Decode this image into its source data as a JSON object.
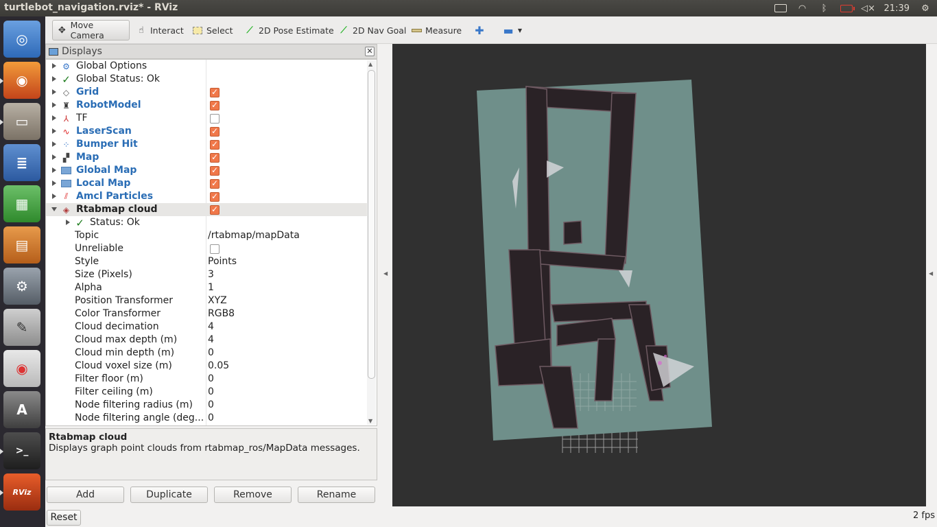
{
  "window": {
    "title": "turtlebot_navigation.rviz* - RViz"
  },
  "tray": {
    "clock": "21:39"
  },
  "toolbar": {
    "move_camera": "Move Camera",
    "interact": "Interact",
    "select": "Select",
    "pose_estimate": "2D Pose Estimate",
    "nav_goal": "2D Nav Goal",
    "measure": "Measure"
  },
  "displays": {
    "title": "Displays",
    "items": [
      {
        "label": "Global Options"
      },
      {
        "label": "Global Status: Ok"
      },
      {
        "label": "Grid"
      },
      {
        "label": "RobotModel"
      },
      {
        "label": "TF"
      },
      {
        "label": "LaserScan"
      },
      {
        "label": "Bumper Hit"
      },
      {
        "label": "Map"
      },
      {
        "label": "Global Map"
      },
      {
        "label": "Local Map"
      },
      {
        "label": "Amcl Particles"
      },
      {
        "label": "Rtabmap cloud"
      },
      {
        "label": "Status: Ok"
      }
    ],
    "properties": [
      {
        "label": "Topic",
        "value": "/rtabmap/mapData"
      },
      {
        "label": "Unreliable",
        "value": ""
      },
      {
        "label": "Style",
        "value": "Points"
      },
      {
        "label": "Size (Pixels)",
        "value": "3"
      },
      {
        "label": "Alpha",
        "value": "1"
      },
      {
        "label": "Position Transformer",
        "value": "XYZ"
      },
      {
        "label": "Color Transformer",
        "value": "RGB8"
      },
      {
        "label": "Cloud decimation",
        "value": "4"
      },
      {
        "label": "Cloud max depth (m)",
        "value": "4"
      },
      {
        "label": "Cloud min depth (m)",
        "value": "0"
      },
      {
        "label": "Cloud voxel size (m)",
        "value": "0.05"
      },
      {
        "label": "Filter floor (m)",
        "value": "0"
      },
      {
        "label": "Filter ceiling (m)",
        "value": "0"
      },
      {
        "label": "Node filtering radius (m)",
        "value": "0"
      },
      {
        "label": "Node filtering angle (deg...",
        "value": "0"
      }
    ],
    "description": {
      "title": "Rtabmap cloud",
      "text": "Displays graph point clouds from rtabmap_ros/MapData messages."
    },
    "buttons": {
      "add": "Add",
      "duplicate": "Duplicate",
      "remove": "Remove",
      "rename": "Rename"
    }
  },
  "launcher": {
    "rviz_label": "RViz"
  },
  "statusbar": {
    "reset": "Reset",
    "fps": "2 fps"
  },
  "colors": {
    "map_floor": "#6f8f8a",
    "view_bg": "#303030",
    "checkbox_on": "#f0784a",
    "display_name": "#2a6db5"
  }
}
